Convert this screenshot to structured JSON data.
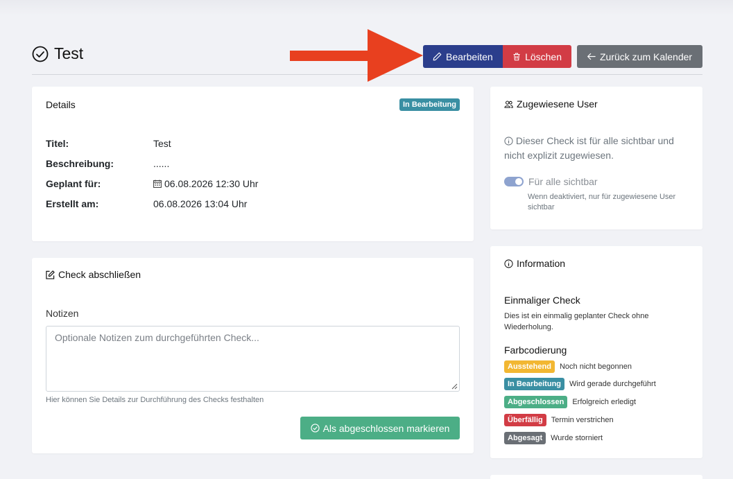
{
  "header": {
    "title": "Test",
    "edit_label": "Bearbeiten",
    "delete_label": "Löschen",
    "back_label": "Zurück zum Kalender"
  },
  "details": {
    "title": "Details",
    "status": "In Bearbeitung",
    "rows": [
      {
        "label": "Titel:",
        "value": "Test"
      },
      {
        "label": "Beschreibung:",
        "value": "......"
      },
      {
        "label": "Geplant für:",
        "value": "06.08.2026 12:30 Uhr"
      },
      {
        "label": "Erstellt am:",
        "value": "06.08.2026 13:04 Uhr"
      }
    ]
  },
  "complete": {
    "title": "Check abschließen",
    "notes_label": "Notizen",
    "notes_placeholder": "Optionale Notizen zum durchgeführten Check...",
    "notes_help": "Hier können Sie Details zur Durchführung des Checks festhalten",
    "submit_label": "Als abgeschlossen markieren"
  },
  "users": {
    "title": "Zugewiesene User",
    "info": "Dieser Check ist für alle sichtbar und nicht explizit zugewiesen.",
    "toggle_label": "Für alle sichtbar",
    "toggle_on": true,
    "toggle_help": "Wenn deaktiviert, nur für zugewiesene User sichtbar"
  },
  "info": {
    "title": "Information",
    "once_heading": "Einmaliger Check",
    "once_text": "Dies ist ein einmalig geplanter Check ohne Wiederholung.",
    "color_heading": "Farbcodierung",
    "legend": [
      {
        "badge": "Ausstehend",
        "text": "Noch nicht begonnen",
        "color": "#f2b732"
      },
      {
        "badge": "In Bearbeitung",
        "text": "Wird gerade durchgeführt",
        "color": "#3a8fa3"
      },
      {
        "badge": "Abgeschlossen",
        "text": "Erfolgreich erledigt",
        "color": "#4cae86"
      },
      {
        "badge": "Überfällig",
        "text": "Termin verstrichen",
        "color": "#d23c45"
      },
      {
        "badge": "Abgesagt",
        "text": "Wurde storniert",
        "color": "#6a6f75"
      }
    ]
  },
  "colors": {
    "primary": "#2b3e8c",
    "danger": "#d23c45",
    "secondary": "#6a6f75",
    "success": "#4cae86",
    "arrow": "#e8401f"
  }
}
